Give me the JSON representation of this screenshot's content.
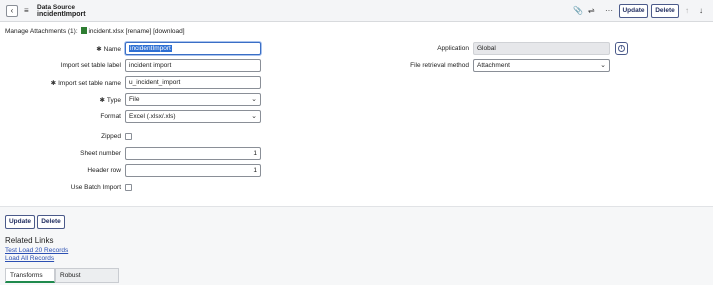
{
  "header": {
    "subtitle": "Data Source",
    "title": "incidentImport",
    "update_label": "Update",
    "delete_label": "Delete"
  },
  "attachments": {
    "prefix": "Manage Attachments (1):",
    "file": "incident.xlsx",
    "actions": "[rename] [download]"
  },
  "form": {
    "name_label": "Name",
    "name_value": "incidentImport",
    "import_label_label": "Import set table label",
    "import_label_value": "incident import",
    "import_name_label": "Import set table name",
    "import_name_value": "u_incident_import",
    "type_label": "Type",
    "type_value": "File",
    "format_label": "Format",
    "format_value": "Excel (.xlsx/.xls)",
    "zipped_label": "Zipped",
    "sheet_label": "Sheet number",
    "sheet_value": "1",
    "header_row_label": "Header row",
    "header_row_value": "1",
    "batch_label": "Use Batch Import",
    "application_label": "Application",
    "application_value": "Global",
    "retrieval_label": "File retrieval method",
    "retrieval_value": "Attachment"
  },
  "footer": {
    "update_label": "Update",
    "delete_label": "Delete",
    "related_title": "Related Links",
    "links": [
      "Test Load 20 Records",
      "Load All Records"
    ],
    "tabs": [
      "Transforms (1)",
      "Robust Transformer"
    ]
  },
  "colors": {
    "accent": "#2d6fd4",
    "tab_active": "#1f8a4d",
    "link": "#2b4fb3"
  }
}
